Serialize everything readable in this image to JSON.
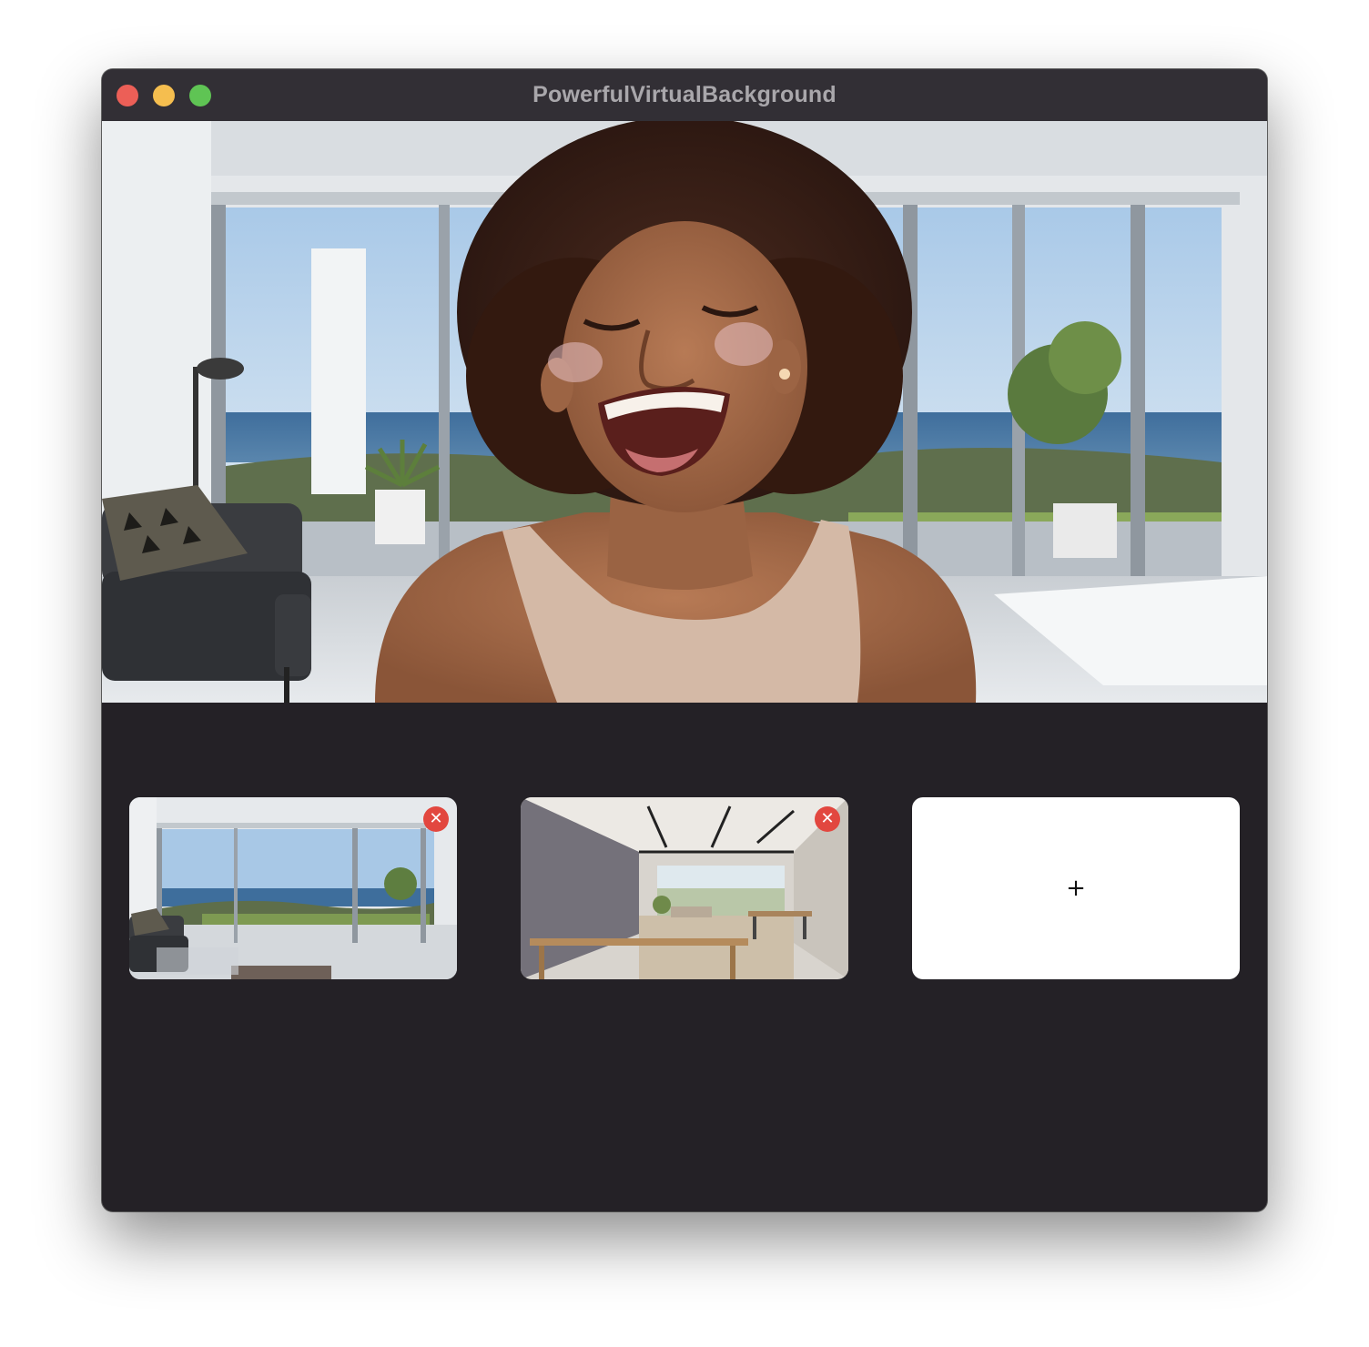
{
  "window": {
    "title": "PowerfulVirtualBackground",
    "controls": [
      "close",
      "minimize",
      "maximize"
    ]
  },
  "preview": {
    "description_icon": "camera-preview"
  },
  "backgrounds": [
    {
      "name": "seaside-living-room",
      "remove_label": "✕"
    },
    {
      "name": "modern-apartment",
      "remove_label": "✕"
    }
  ],
  "add_tile": {
    "label": "+"
  },
  "colors": {
    "window_bg": "#242126",
    "titlebar_bg": "#322f35",
    "close": "#ec5f57",
    "minimize": "#f5be4f",
    "maximize": "#5fc454",
    "remove": "#e2473f"
  }
}
